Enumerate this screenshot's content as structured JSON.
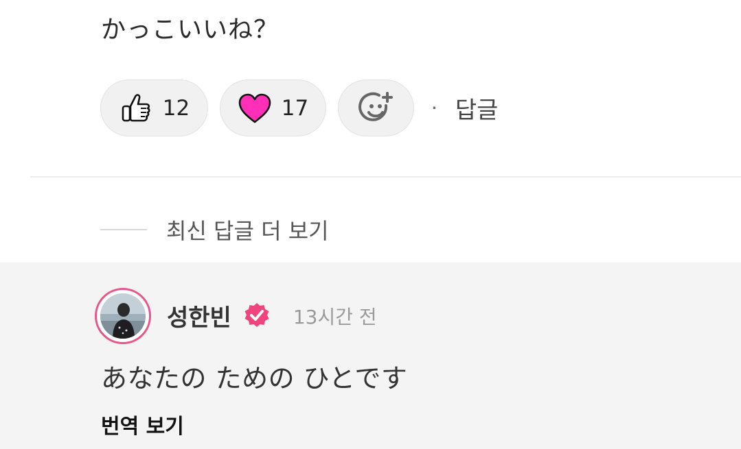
{
  "comment": {
    "text": "かっこいいね？"
  },
  "reactions": {
    "like": {
      "icon": "thumbs-up-icon",
      "count": "12"
    },
    "heart": {
      "icon": "heart-icon",
      "count": "17",
      "color": "#ff2fb8"
    },
    "add": {
      "icon": "add-reaction-icon"
    },
    "separator": "·",
    "reply_label": "답글"
  },
  "more_replies": {
    "label": "최신 답글 더 보기"
  },
  "reply": {
    "author": "성한빈",
    "verified_icon": "verified-badge-icon",
    "verified_color": "#f0447f",
    "avatar_ring_color": "#e8558a",
    "timestamp": "13시간 전",
    "text": "あなたの ための ひとです",
    "translate_label": "번역 보기"
  }
}
